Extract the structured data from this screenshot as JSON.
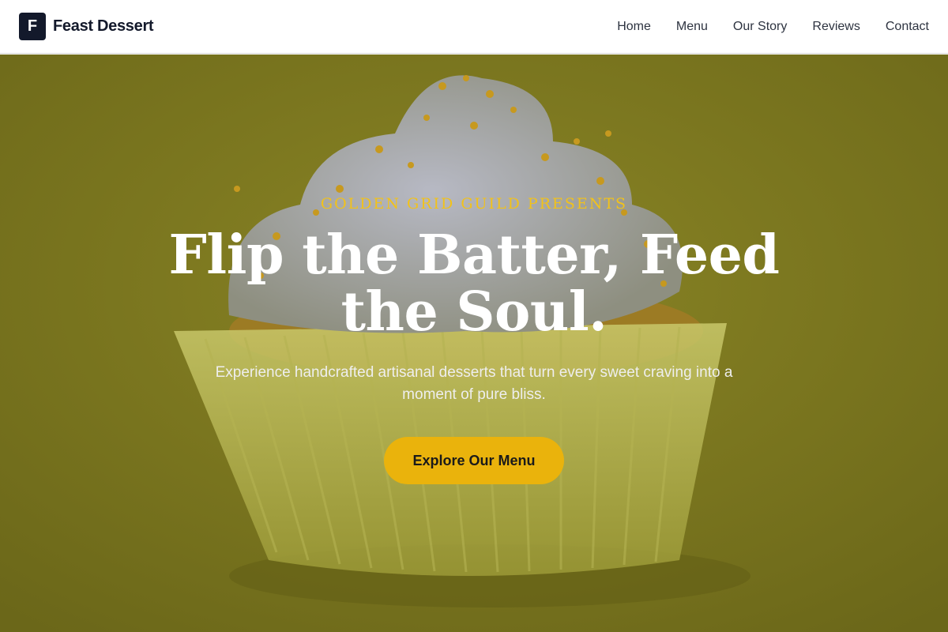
{
  "brand": {
    "logo_letter": "F",
    "name": "Feast Dessert"
  },
  "nav": {
    "items": [
      {
        "label": "Home"
      },
      {
        "label": "Menu"
      },
      {
        "label": "Our Story"
      },
      {
        "label": "Reviews"
      },
      {
        "label": "Contact"
      }
    ]
  },
  "hero": {
    "eyebrow": "GOLDEN GRID GUILD PRESENTS",
    "headline": "Flip the Batter, Feed the Soul.",
    "subheading": "Experience handcrafted artisanal desserts that turn every sweet craving into a moment of pure bliss.",
    "cta_label": "Explore Our Menu",
    "background_image": "cupcake-photo"
  },
  "colors": {
    "brand_dark": "#13192b",
    "accent_gold": "#eab30c",
    "eyebrow_gold": "#f2c21a",
    "hero_overlay": "#6e6b1c"
  }
}
